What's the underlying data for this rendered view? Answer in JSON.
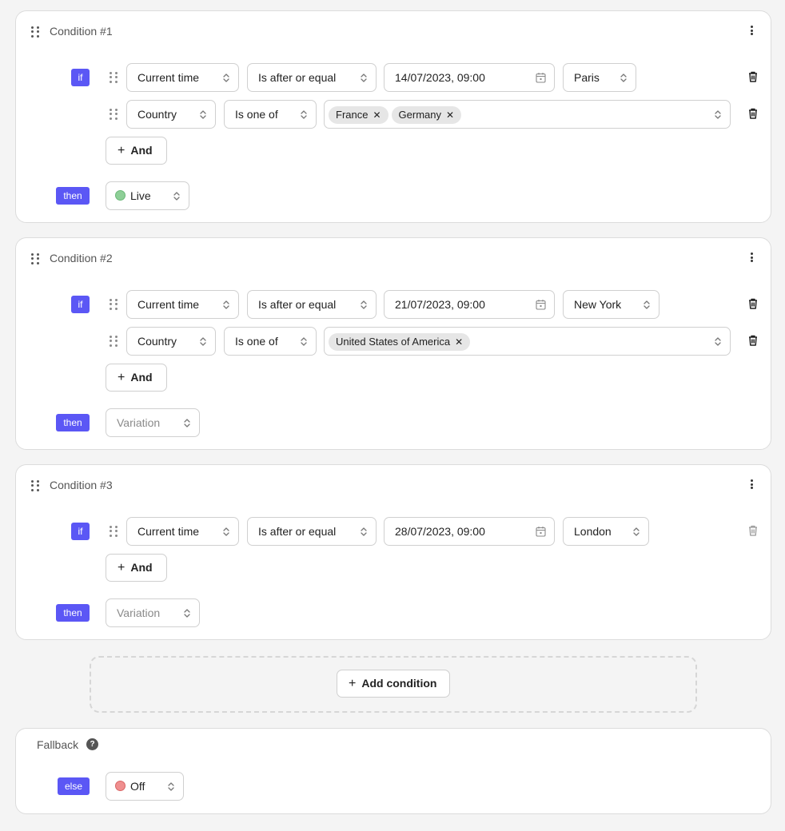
{
  "conditions": [
    {
      "title": "Condition #1",
      "if_label": "if",
      "then_label": "then",
      "rules": [
        {
          "field": "Current time",
          "operator": "Is after or equal",
          "value": "14/07/2023, 09:00",
          "timezone": "Paris"
        },
        {
          "field": "Country",
          "operator": "Is one of",
          "chips": [
            "France",
            "Germany"
          ]
        }
      ],
      "and_label": "And",
      "then_value": "Live",
      "then_color": "#7fc88a"
    },
    {
      "title": "Condition #2",
      "if_label": "if",
      "then_label": "then",
      "rules": [
        {
          "field": "Current time",
          "operator": "Is after or equal",
          "value": "21/07/2023, 09:00",
          "timezone": "New York"
        },
        {
          "field": "Country",
          "operator": "Is one of",
          "chips": [
            "United States of America"
          ]
        }
      ],
      "and_label": "And",
      "then_placeholder": "Variation"
    },
    {
      "title": "Condition #3",
      "if_label": "if",
      "then_label": "then",
      "rules": [
        {
          "field": "Current time",
          "operator": "Is after or equal",
          "value": "28/07/2023, 09:00",
          "timezone": "London"
        }
      ],
      "and_label": "And",
      "then_placeholder": "Variation"
    }
  ],
  "add_condition_label": "Add condition",
  "fallback": {
    "title": "Fallback",
    "help_icon": "?",
    "else_label": "else",
    "value": "Off",
    "color": "#e87b7b"
  },
  "colors": {
    "accent": "#5b57f5"
  }
}
